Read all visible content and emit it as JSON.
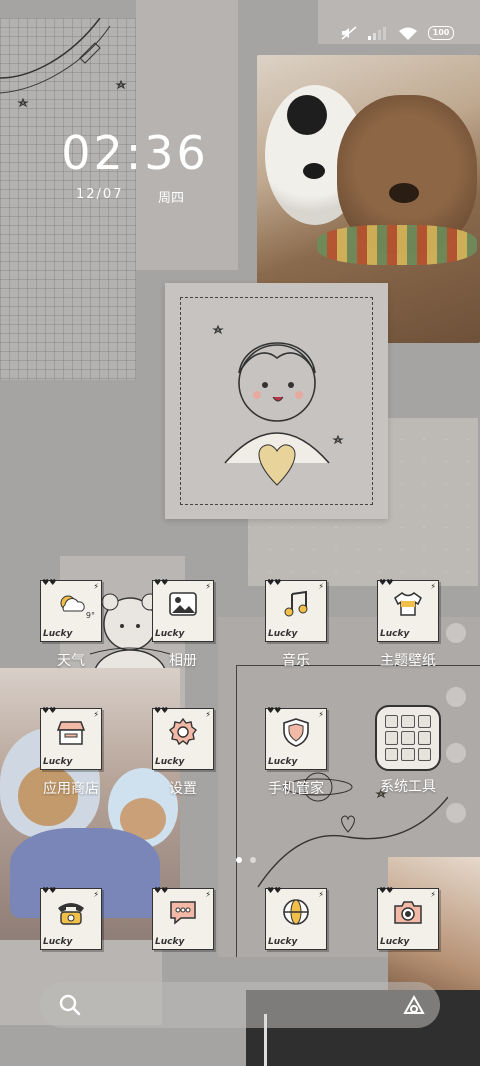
{
  "status_bar": {
    "icons": [
      "mute-icon",
      "signal-icon",
      "wifi-icon",
      "battery-icon"
    ],
    "battery": "100"
  },
  "clock": {
    "time": "02:36",
    "date": "12/07",
    "weekday": "周四"
  },
  "apps": [
    {
      "label": "天气",
      "icon": "weather-icon",
      "badge": "Lucky",
      "temp": "9°"
    },
    {
      "label": "相册",
      "icon": "gallery-icon",
      "badge": "Lucky"
    },
    {
      "label": "音乐",
      "icon": "music-icon",
      "badge": "Lucky"
    },
    {
      "label": "主题壁纸",
      "icon": "theme-icon",
      "badge": "Lucky"
    },
    {
      "label": "应用商店",
      "icon": "store-icon",
      "badge": "Lucky"
    },
    {
      "label": "设置",
      "icon": "settings-icon",
      "badge": "Lucky"
    },
    {
      "label": "手机管家",
      "icon": "security-icon",
      "badge": "Lucky"
    },
    {
      "label": "系统工具",
      "icon": "folder-icon"
    }
  ],
  "dock": [
    {
      "icon": "phone-icon",
      "badge": "Lucky"
    },
    {
      "icon": "messages-icon",
      "badge": "Lucky"
    },
    {
      "icon": "browser-icon",
      "badge": "Lucky"
    },
    {
      "icon": "camera-icon",
      "badge": "Lucky"
    }
  ],
  "search_bar": {
    "icons": [
      "search-icon",
      "assistant-icon"
    ]
  },
  "page_indicator": {
    "pages": 2,
    "current": 1
  }
}
